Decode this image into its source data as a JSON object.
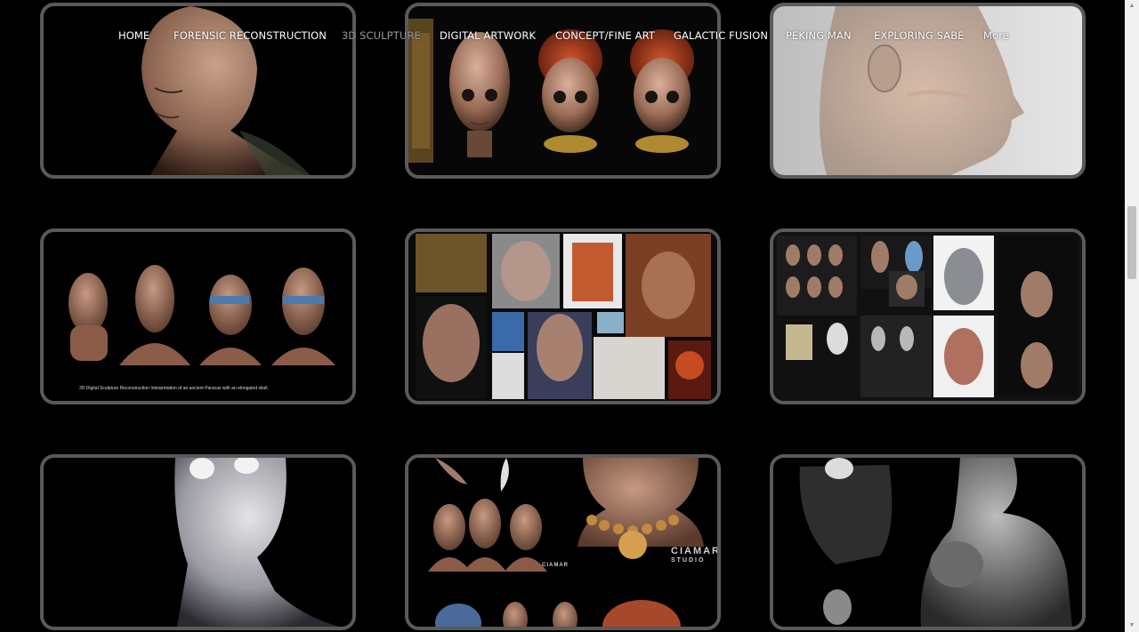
{
  "nav": {
    "items": [
      {
        "label": "HOME"
      },
      {
        "label": "FORENSIC RECONSTRUCTION"
      },
      {
        "label": "3D SCULPTURE",
        "current": true
      },
      {
        "label": "DIGITAL ARTWORK"
      },
      {
        "label": "CONCEPT/FINE ART"
      },
      {
        "label": "GALACTIC FUSION"
      },
      {
        "label": "PEKING MAN"
      },
      {
        "label": "EXPLORING SABÉ"
      },
      {
        "label": "More"
      }
    ]
  },
  "gallery": {
    "tiles": [
      {
        "name": "bald-head-sculpture"
      },
      {
        "name": "elongated-child-heads-trio"
      },
      {
        "name": "translucent-head-profile"
      },
      {
        "name": "paracas-busts-panel",
        "caption": "3D Digital Sculpture Reconstruction Interpretation of an ancient Paracas with an elongated skull."
      },
      {
        "name": "reconstruction-collage"
      },
      {
        "name": "sculpture-process-sheet"
      },
      {
        "name": "wide-eyed-figure"
      },
      {
        "name": "ciamar-busts",
        "watermark_main": "CIAMAR",
        "watermark_sub": "STUDIO",
        "watermark_small": "CIAMAR"
      },
      {
        "name": "monochrome-warrior"
      }
    ]
  },
  "colors": {
    "background": "#000000",
    "tile_border": "#5a5a5a",
    "nav_text": "#ffffff",
    "nav_current": "#9a9a9a"
  }
}
